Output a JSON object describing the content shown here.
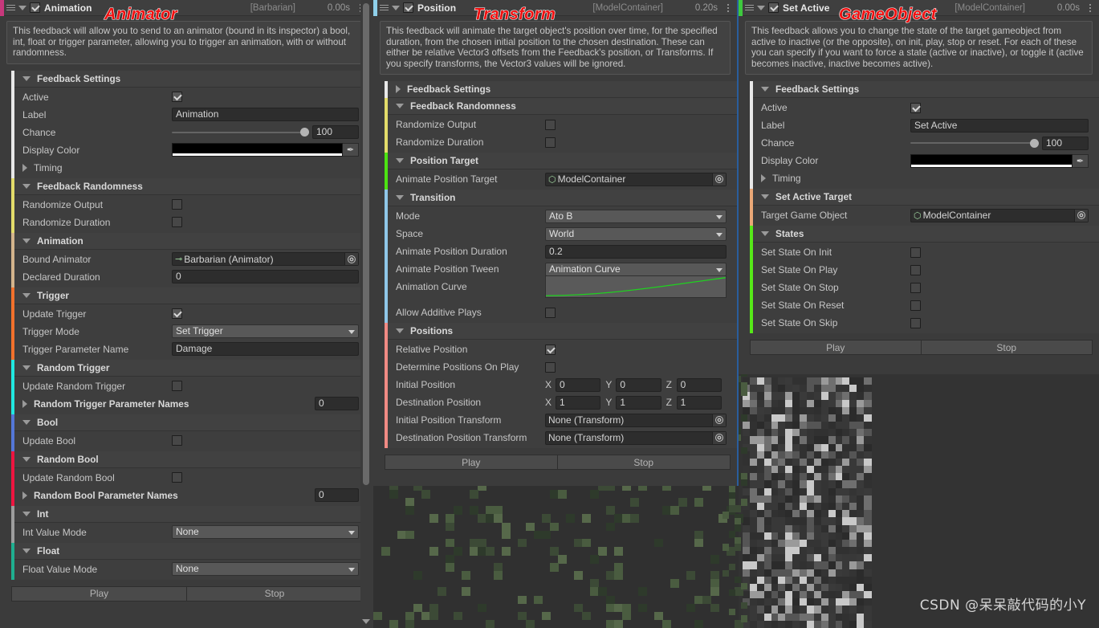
{
  "panels": [
    {
      "id": "animator",
      "accent": "#c8387c",
      "title": "Animation",
      "owner": "[Barbarian]",
      "time": "0.00s",
      "stamp": "Animator",
      "enabled": true,
      "description": "This feedback will allow you to send to an animator (bound in its inspector) a bool, int, float or trigger parameter, allowing you to trigger an animation, with or without randomness.",
      "play_label": "Play",
      "stop_label": "Stop",
      "sections": [
        {
          "name": "Feedback Settings",
          "bar": "#e8e8e8",
          "expanded": true,
          "rows": [
            {
              "type": "checkbox",
              "label": "Active",
              "value": true
            },
            {
              "type": "text",
              "label": "Label",
              "value": "Animation"
            },
            {
              "type": "slider",
              "label": "Chance",
              "value": "100",
              "percent": 100
            },
            {
              "type": "color",
              "label": "Display Color",
              "value": "#000000"
            },
            {
              "type": "foldout-inline",
              "label": "Timing"
            }
          ]
        },
        {
          "name": "Feedback Randomness",
          "bar": "#e3dc6a",
          "expanded": true,
          "rows": [
            {
              "type": "checkbox",
              "label": "Randomize Output",
              "value": false
            },
            {
              "type": "checkbox",
              "label": "Randomize Duration",
              "value": false
            }
          ]
        },
        {
          "name": "Animation",
          "bar": "#d3b48c",
          "expanded": true,
          "rows": [
            {
              "type": "object",
              "label": "Bound Animator",
              "value": "Barbarian (Animator)",
              "icon": "animator-icon"
            },
            {
              "type": "text",
              "label": "Declared Duration",
              "value": "0"
            }
          ]
        },
        {
          "name": "Trigger",
          "bar": "#f2712c",
          "expanded": true,
          "rows": [
            {
              "type": "checkbox",
              "label": "Update Trigger",
              "value": true
            },
            {
              "type": "dropdown",
              "label": "Trigger Mode",
              "value": "Set Trigger"
            },
            {
              "type": "text",
              "label": "Trigger Parameter Name",
              "value": "Damage"
            }
          ]
        },
        {
          "name": "Random Trigger",
          "bar": "#21e8e0",
          "expanded": true,
          "rows": [
            {
              "type": "checkbox",
              "label": "Update Random Trigger",
              "value": false
            },
            {
              "type": "list",
              "label": "Random Trigger Parameter Names",
              "count": "0"
            }
          ]
        },
        {
          "name": "Bool",
          "bar": "#5477d8",
          "expanded": true,
          "rows": [
            {
              "type": "checkbox",
              "label": "Update Bool",
              "value": false
            }
          ]
        },
        {
          "name": "Random Bool",
          "bar": "#ee1540",
          "expanded": true,
          "rows": [
            {
              "type": "checkbox",
              "label": "Update Random Bool",
              "value": false
            },
            {
              "type": "list",
              "label": "Random Bool Parameter Names",
              "count": "0"
            }
          ]
        },
        {
          "name": "Int",
          "bar": "#9d9d9d",
          "expanded": true,
          "rows": [
            {
              "type": "dropdown",
              "label": "Int Value Mode",
              "value": "None"
            }
          ]
        },
        {
          "name": "Float",
          "bar": "#1fae8f",
          "expanded": true,
          "rows": [
            {
              "type": "dropdown",
              "label": "Float Value Mode",
              "value": "None"
            }
          ]
        }
      ]
    },
    {
      "id": "transform",
      "accent": "#8fd0ea",
      "title": "Position",
      "owner": "[ModelContainer]",
      "time": "0.20s",
      "stamp": "Transform",
      "enabled": true,
      "description": "This feedback will animate the target object's position over time, for the specified duration, from the chosen initial position to the chosen destination. These can either be relative Vector3 offsets from the Feedback's position, or Transforms. If you specify transforms, the Vector3 values will be ignored.",
      "play_label": "Play",
      "stop_label": "Stop",
      "sections": [
        {
          "name": "Feedback Settings",
          "bar": "#e8e8e8",
          "expanded": false,
          "rows": []
        },
        {
          "name": "Feedback Randomness",
          "bar": "#e3dc6a",
          "expanded": true,
          "rows": [
            {
              "type": "checkbox",
              "label": "Randomize Output",
              "value": false
            },
            {
              "type": "checkbox",
              "label": "Randomize Duration",
              "value": false
            }
          ]
        },
        {
          "name": "Position Target",
          "bar": "#4ce312",
          "expanded": true,
          "rows": [
            {
              "type": "object",
              "label": "Animate Position Target",
              "value": "ModelContainer",
              "icon": "gameobject-icon"
            }
          ]
        },
        {
          "name": "Transition",
          "bar": "#8fc7e8",
          "expanded": true,
          "rows": [
            {
              "type": "dropdown",
              "label": "Mode",
              "value": "Ato B"
            },
            {
              "type": "dropdown",
              "label": "Space",
              "value": "World"
            },
            {
              "type": "text",
              "label": "Animate Position Duration",
              "value": "0.2"
            },
            {
              "type": "dropdown",
              "label": "Animate Position Tween",
              "value": "Animation Curve"
            },
            {
              "type": "curve",
              "label": "Animation Curve",
              "color": "#1fd21f"
            },
            {
              "type": "spacer"
            },
            {
              "type": "checkbox",
              "label": "Allow Additive Plays",
              "value": false
            }
          ]
        },
        {
          "name": "Positions",
          "bar": "#f08a84",
          "expanded": true,
          "rows": [
            {
              "type": "checkbox",
              "label": "Relative Position",
              "value": true
            },
            {
              "type": "checkbox",
              "label": "Determine Positions On Play",
              "value": false
            },
            {
              "type": "vector3",
              "label": "Initial Position",
              "x": "0",
              "y": "0",
              "z": "0"
            },
            {
              "type": "vector3",
              "label": "Destination Position",
              "x": "1",
              "y": "1",
              "z": "1"
            },
            {
              "type": "object",
              "label": "Initial Position Transform",
              "value": "None (Transform)",
              "icon": "none-icon"
            },
            {
              "type": "object",
              "label": "Destination Position Transform",
              "value": "None (Transform)",
              "icon": "none-icon"
            }
          ]
        }
      ]
    },
    {
      "id": "gameobject",
      "accent": "#3ec93e",
      "title": "Set Active",
      "owner": "[ModelContainer]",
      "time": "0.00s",
      "stamp": "GameObject",
      "enabled": true,
      "description": "This feedback allows you to change the state of the target gameobject from active to inactive (or the opposite), on init, play, stop or reset. For each of these you can specify if you want to force a state (active or inactive), or toggle it (active becomes inactive, inactive becomes active).",
      "play_label": "Play",
      "stop_label": "Stop",
      "sections": [
        {
          "name": "Feedback Settings",
          "bar": "#e8e8e8",
          "expanded": true,
          "rows": [
            {
              "type": "checkbox",
              "label": "Active",
              "value": true
            },
            {
              "type": "text",
              "label": "Label",
              "value": "Set Active"
            },
            {
              "type": "slider",
              "label": "Chance",
              "value": "100",
              "percent": 100
            },
            {
              "type": "color",
              "label": "Display Color",
              "value": "#000000"
            },
            {
              "type": "foldout-inline",
              "label": "Timing"
            }
          ]
        },
        {
          "name": "Set Active Target",
          "bar": "#eaa877",
          "expanded": true,
          "rows": [
            {
              "type": "object",
              "label": "Target Game Object",
              "value": "ModelContainer",
              "icon": "gameobject-icon"
            }
          ]
        },
        {
          "name": "States",
          "bar": "#56e818",
          "expanded": true,
          "rows": [
            {
              "type": "checkbox",
              "label": "Set State On Init",
              "value": false
            },
            {
              "type": "checkbox",
              "label": "Set State On Play",
              "value": false
            },
            {
              "type": "checkbox",
              "label": "Set State On Stop",
              "value": false
            },
            {
              "type": "checkbox",
              "label": "Set State On Reset",
              "value": false
            },
            {
              "type": "checkbox",
              "label": "Set State On Skip",
              "value": false
            }
          ]
        }
      ]
    }
  ],
  "watermark": "CSDN @呆呆敲代码的小Y"
}
